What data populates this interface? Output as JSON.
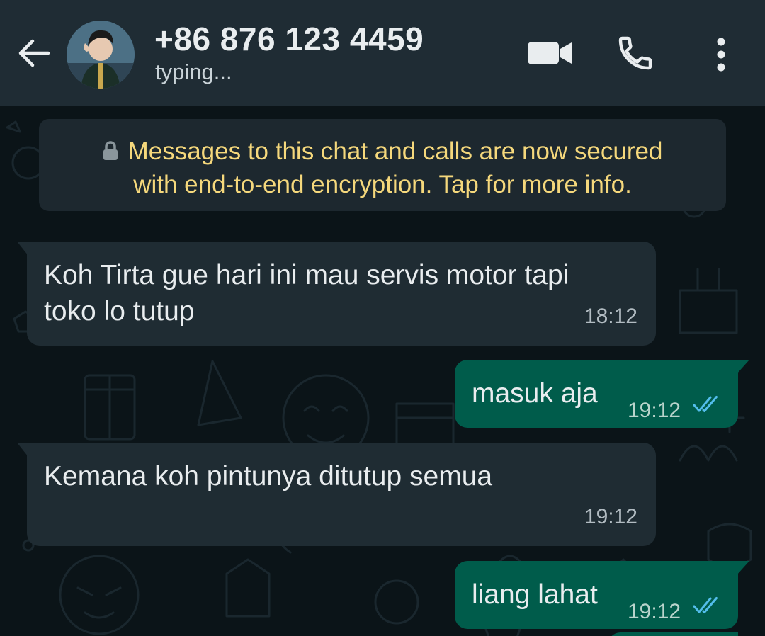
{
  "header": {
    "contact_name": "+86 876 123 4459",
    "status": "typing...",
    "back_icon": "arrow-left-icon",
    "video_icon": "video-camera-icon",
    "call_icon": "phone-icon",
    "menu_icon": "more-vertical-icon"
  },
  "notice": {
    "line1": "Messages to this chat and calls are now secured",
    "line2": "with end-to-end encryption. Tap for more info.",
    "icon": "lock-icon"
  },
  "messages": [
    {
      "direction": "incoming",
      "lines": [
        "Koh Tirta gue hari ini mau servis motor tapi",
        "toko lo tutup"
      ],
      "time": "18:12"
    },
    {
      "direction": "outgoing",
      "text": "masuk aja",
      "time": "19:12",
      "status": "read"
    },
    {
      "direction": "incoming",
      "text": "Kemana koh pintunya ditutup semua",
      "time": "19:12"
    },
    {
      "direction": "outgoing",
      "text": "liang lahat",
      "time": "19:12",
      "status": "read"
    }
  ],
  "colors": {
    "header_bg": "#1f2c34",
    "chat_bg": "#0b1418",
    "incoming_bubble": "#1f2c33",
    "outgoing_bubble": "#005c4b",
    "notice_text": "#f5d87c",
    "read_ticks": "#53bdeb"
  }
}
